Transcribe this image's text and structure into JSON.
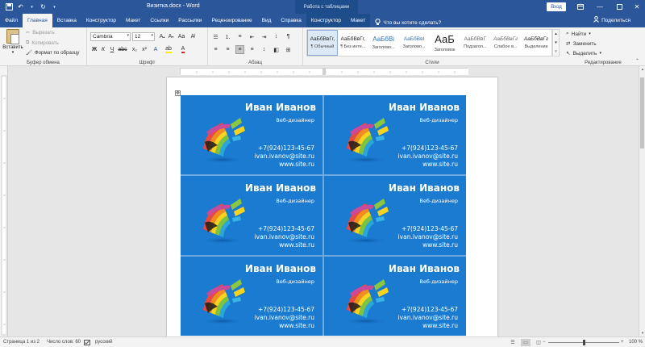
{
  "app": {
    "doc_title": "Визитка.docx",
    "app_sep": "-",
    "app_name": "Word",
    "context_title": "Работа с таблицами",
    "signin": "Вход"
  },
  "tabs": [
    {
      "label": "Файл"
    },
    {
      "label": "Главная"
    },
    {
      "label": "Вставка"
    },
    {
      "label": "Конструктор"
    },
    {
      "label": "Макет"
    },
    {
      "label": "Ссылки"
    },
    {
      "label": "Рассылки"
    },
    {
      "label": "Рецензирование"
    },
    {
      "label": "Вид"
    },
    {
      "label": "Справка"
    },
    {
      "label": "Конструктор"
    },
    {
      "label": "Макет"
    }
  ],
  "tellme": "Что вы хотите сделать?",
  "share": "Поделиться",
  "clipboard": {
    "paste": "Вставить",
    "cut": "Вырезать",
    "copy": "Копировать",
    "format_painter": "Формат по образцу",
    "label": "Буфер обмена"
  },
  "font": {
    "name": "Cambria",
    "size": "12",
    "label": "Шрифт"
  },
  "paragraph": {
    "label": "Абзац"
  },
  "styles": {
    "label": "Стили",
    "items": [
      {
        "sample": "АаБбВвГг,",
        "name": "¶ Обычный"
      },
      {
        "sample": "АаБбВвГг,",
        "name": "¶ Без инте..."
      },
      {
        "sample": "АаБбВі",
        "name": "Заголово..."
      },
      {
        "sample": "АаБбВвІ",
        "name": "Заголово..."
      },
      {
        "sample": "АаБ",
        "name": "Заголовок"
      },
      {
        "sample": "АаБбВвГ",
        "name": "Подзагол..."
      },
      {
        "sample": "АаБбВвГг",
        "name": "Слабое в..."
      },
      {
        "sample": "АаБбВвГг",
        "name": "Выделение"
      }
    ]
  },
  "editing": {
    "find": "Найти",
    "replace": "Заменить",
    "select": "Выделить",
    "label": "Редактирование"
  },
  "card": {
    "name": "Иван Иванов",
    "role": "Веб-дизайнер",
    "phone": "+7(924)123-45-67",
    "email": "ivan.ivanov@site.ru",
    "site": "www.site.ru"
  },
  "status": {
    "page": "Страница 1 из 2",
    "words": "Число слов: 60",
    "lang": "русский",
    "zoom": "100 %",
    "zoom_level": 0.5
  },
  "colors": {
    "accent": "#2b579a",
    "card_bg": "#1a7bd1"
  }
}
